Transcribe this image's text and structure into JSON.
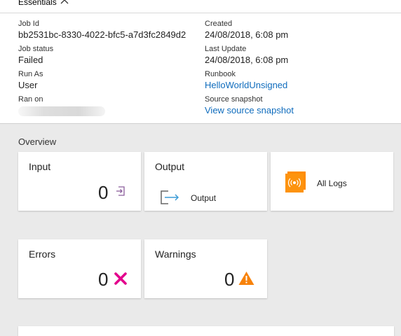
{
  "essentials": {
    "title": "Essentials",
    "job_id": {
      "label": "Job Id",
      "value": "bb2531bc-8330-4022-bfc5-a7d3fc2849d2"
    },
    "job_status": {
      "label": "Job status",
      "value": "Failed"
    },
    "run_as": {
      "label": "Run As",
      "value": "User"
    },
    "ran_on": {
      "label": "Ran on"
    },
    "created": {
      "label": "Created",
      "value": "24/08/2018, 6:08 pm"
    },
    "last_update": {
      "label": "Last Update",
      "value": "24/08/2018, 6:08 pm"
    },
    "runbook": {
      "label": "Runbook",
      "value": "HelloWorldUnsigned"
    },
    "source_snapshot": {
      "label": "Source snapshot",
      "value": "View source snapshot"
    }
  },
  "overview": {
    "title": "Overview",
    "input": {
      "title": "Input",
      "count": "0"
    },
    "output": {
      "title": "Output",
      "label": "Output"
    },
    "all_logs": {
      "label": "All Logs"
    },
    "errors": {
      "title": "Errors",
      "count": "0"
    },
    "warnings": {
      "title": "Warnings",
      "count": "0"
    }
  },
  "icons": {
    "collapse": "chevron-up-icon",
    "input": "input-arrow-icon",
    "output": "output-arrow-icon",
    "logs": "logs-book-icon",
    "error": "error-x-icon",
    "warning": "warning-triangle-icon"
  },
  "colors": {
    "link": "#0f6cbd",
    "error": "#e3008c",
    "warning": "#f7820b",
    "logs": "#ff8c00",
    "input_icon": "#8b5e9c",
    "output_icon": "#3b9bd6"
  }
}
